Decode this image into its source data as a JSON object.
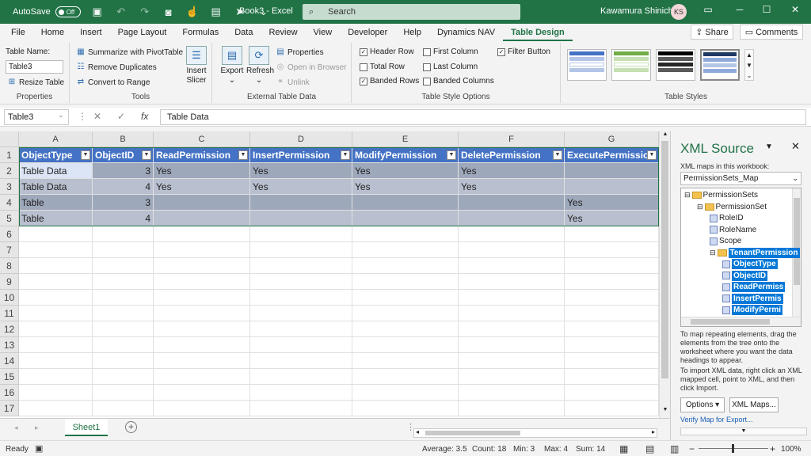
{
  "titlebar": {
    "autosave_label": "AutoSave",
    "autosave_state": "Off",
    "title": "Book3  -  Excel",
    "search_placeholder": "Search",
    "user": "Kawamura Shinichi",
    "initials": "KS"
  },
  "tabs": [
    "File",
    "Home",
    "Insert",
    "Page Layout",
    "Formulas",
    "Data",
    "Review",
    "View",
    "Developer",
    "Help",
    "Dynamics NAV",
    "Table Design"
  ],
  "active_tab": "Table Design",
  "share_label": "Share",
  "comments_label": "Comments",
  "ribbon": {
    "properties": {
      "name_label": "Table Name:",
      "name_value": "Table3",
      "resize": "Resize Table",
      "group": "Properties"
    },
    "tools": {
      "summarize": "Summarize with PivotTable",
      "remove_dup": "Remove Duplicates",
      "convert": "Convert to Range",
      "insert_slicer": "Insert Slicer",
      "group": "Tools"
    },
    "external": {
      "export": "Export",
      "refresh": "Refresh",
      "properties": "Properties",
      "open_browser": "Open in Browser",
      "unlink": "Unlink",
      "group": "External Table Data"
    },
    "style_options": {
      "header_row": "Header Row",
      "total_row": "Total Row",
      "banded_rows": "Banded Rows",
      "first_column": "First Column",
      "last_column": "Last Column",
      "banded_columns": "Banded Columns",
      "filter_button": "Filter Button",
      "group": "Table Style Options"
    },
    "styles_group": "Table Styles"
  },
  "formula_bar": {
    "name_box": "Table3",
    "formula": "Table Data"
  },
  "columns": [
    "A",
    "B",
    "C",
    "D",
    "E",
    "F",
    "G"
  ],
  "rows": [
    "1",
    "2",
    "3",
    "4",
    "5",
    "6",
    "7",
    "8",
    "9",
    "10",
    "11",
    "12",
    "13",
    "14",
    "15",
    "16",
    "17"
  ],
  "table": {
    "headers": [
      "ObjectType",
      "ObjectID",
      "ReadPermission",
      "InsertPermission",
      "ModifyPermission",
      "DeletePermission",
      "ExecutePermission"
    ],
    "data": [
      [
        "Table Data",
        "3",
        "Yes",
        "Yes",
        "Yes",
        "Yes",
        ""
      ],
      [
        "Table Data",
        "4",
        "Yes",
        "Yes",
        "Yes",
        "Yes",
        ""
      ],
      [
        "Table",
        "3",
        "",
        "",
        "",
        "",
        "Yes"
      ],
      [
        "Table",
        "4",
        "",
        "",
        "",
        "",
        "Yes"
      ]
    ]
  },
  "sheet_tab": "Sheet1",
  "status": {
    "ready": "Ready",
    "average": "Average: 3.5",
    "count": "Count: 18",
    "min": "Min: 3",
    "max": "Max: 4",
    "sum": "Sum: 14",
    "zoom": "100%"
  },
  "xml_source": {
    "title": "XML Source",
    "maps_label": "XML maps in this workbook:",
    "map_name": "PermissionSets_Map",
    "tree": [
      "PermissionSets",
      "PermissionSet",
      "RoleID",
      "RoleName",
      "Scope",
      "TenantPermission",
      "ObjectType",
      "ObjectID",
      "ReadPermiss",
      "InsertPermis",
      "ModifyPermi"
    ],
    "help1": "To map repeating elements, drag the elements from the tree onto the worksheet where you want the data headings to appear.",
    "help2": "To import XML data, right click an XML mapped cell, point to XML, and then click Import.",
    "options": "Options",
    "xml_maps": "XML Maps...",
    "verify": "Verify Map for Export..."
  }
}
